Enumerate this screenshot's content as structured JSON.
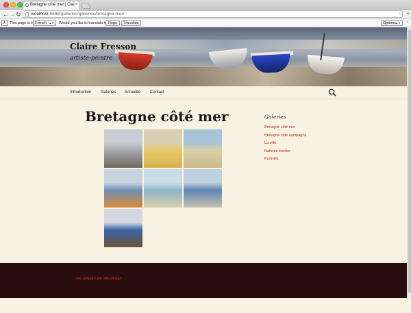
{
  "browser": {
    "tab_title": "Bretagne côté mer | Clai",
    "tab_close": "×",
    "url_host": "localhost",
    "url_path": ":8888/galleries/galleries/bretagne-mer/"
  },
  "translate_bar": {
    "prefix": "This page is in",
    "language": "French",
    "question": "Would you like to translate it?",
    "nope": "Nope",
    "translate": "Translate",
    "options": "Options"
  },
  "site": {
    "title": "Claire Fresson",
    "description": "artiste-peintre"
  },
  "nav": {
    "items": [
      "Introduction",
      "Galeries",
      "Actualité",
      "Contact"
    ]
  },
  "entry": {
    "title": "Bretagne côté mer"
  },
  "gallery": {
    "thumbs": [
      {
        "name": "thumb-1",
        "sky": "#c9ccd3",
        "mid": "#a4a7ab",
        "ground": "#6e6a5e"
      },
      {
        "name": "thumb-2",
        "sky": "#d7cfb0",
        "mid": "#e7c967",
        "ground": "#d9b252"
      },
      {
        "name": "thumb-3",
        "sky": "#a8c2d7",
        "mid": "#d9cfa7",
        "ground": "#cdb98e"
      },
      {
        "name": "thumb-4",
        "sky": "#c9d3e0",
        "mid": "#6e8fb4",
        "ground": "#d98b3a"
      },
      {
        "name": "thumb-5",
        "sky": "#c8dde6",
        "mid": "#8fb5c9",
        "ground": "#d9cdb0"
      },
      {
        "name": "thumb-6",
        "sky": "#bfd0df",
        "mid": "#5e86b0",
        "ground": "#c9c1b2"
      },
      {
        "name": "thumb-7",
        "sky": "#d5d8e0",
        "mid": "#3a64a8",
        "ground": "#6f5238"
      }
    ]
  },
  "sidebar": {
    "title": "Galeries",
    "links": [
      "Bretagne côté mer",
      "Bretagne côté campagne",
      "La ville",
      "Natures mortes",
      "Portraits"
    ]
  },
  "footer": {
    "text": "Site préparé par site-design"
  }
}
